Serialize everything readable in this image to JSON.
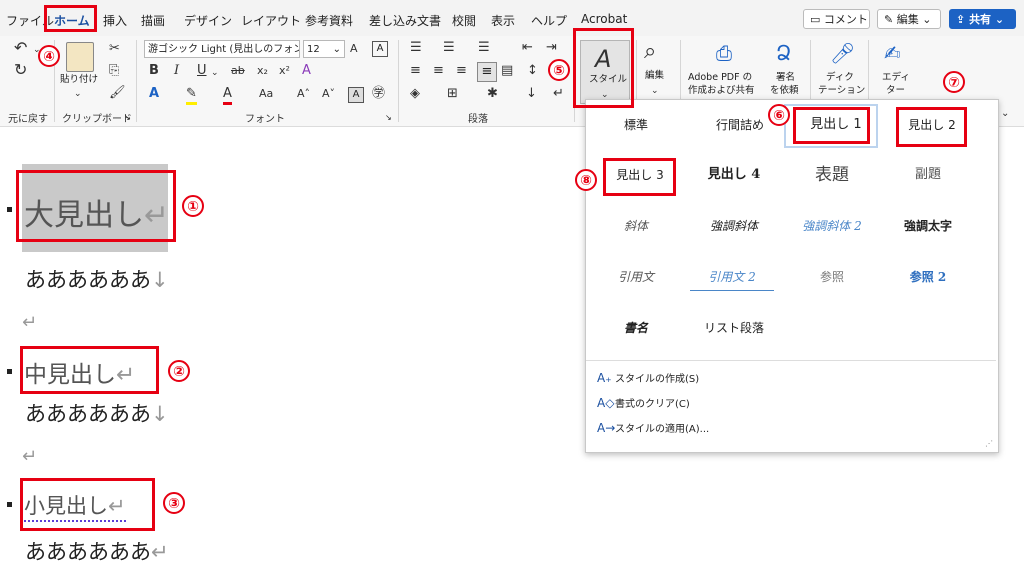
{
  "tabs": [
    "ファイル",
    "ホーム",
    "挿入",
    "描画",
    "デザイン",
    "レイアウト",
    "参考資料",
    "差し込み文書",
    "校閲",
    "表示",
    "ヘルプ",
    "Acrobat"
  ],
  "top_buttons": {
    "comment": "コメント",
    "edit": "編集",
    "share": "共有"
  },
  "ribbon": {
    "undo_group": "元に戻す",
    "clipboard": {
      "paste": "貼り付け",
      "label": "クリップボード"
    },
    "font": {
      "name": "游ゴシック Light (見出しのフォン",
      "size": "12",
      "label": "フォント"
    },
    "paragraph": {
      "label": "段落"
    },
    "styles": {
      "label": "スタイル"
    },
    "edit": {
      "label": "編集"
    },
    "adobe": {
      "line1": "Adobe PDF の",
      "line2": "作成および共有"
    },
    "sign": {
      "line1": "署名",
      "line2": "を依頼"
    },
    "dictate": {
      "line1": "ディク",
      "line2": "テーション"
    },
    "editor": {
      "line1": "エディ",
      "line2": "ター"
    }
  },
  "gallery": {
    "rows": [
      [
        "標準",
        "行間詰め",
        "見出し 1",
        "見出し 2"
      ],
      [
        "見出し 3",
        "見出し 4",
        "表題",
        "副題"
      ],
      [
        "斜体",
        "強調斜体",
        "強調斜体 2",
        "強調太字"
      ],
      [
        "引用文",
        "引用文 2",
        "参照",
        "参照 2"
      ],
      [
        "書名",
        "リスト段落",
        "",
        ""
      ]
    ],
    "footer": [
      "スタイルの作成(S)",
      "書式のクリア(C)",
      "スタイルの適用(A)..."
    ]
  },
  "document": {
    "h1": "大見出し",
    "h2": "中見出し",
    "h3": "小見出し",
    "body": "ああああああ",
    "para_mark": "↵",
    "line_mark": "↓"
  },
  "annotations": [
    "④",
    "⑤",
    "⑥",
    "⑦",
    "⑧",
    "①",
    "②",
    "③"
  ],
  "colors": {
    "accent_red": "#e60012",
    "brand_blue": "#1c62c4"
  }
}
